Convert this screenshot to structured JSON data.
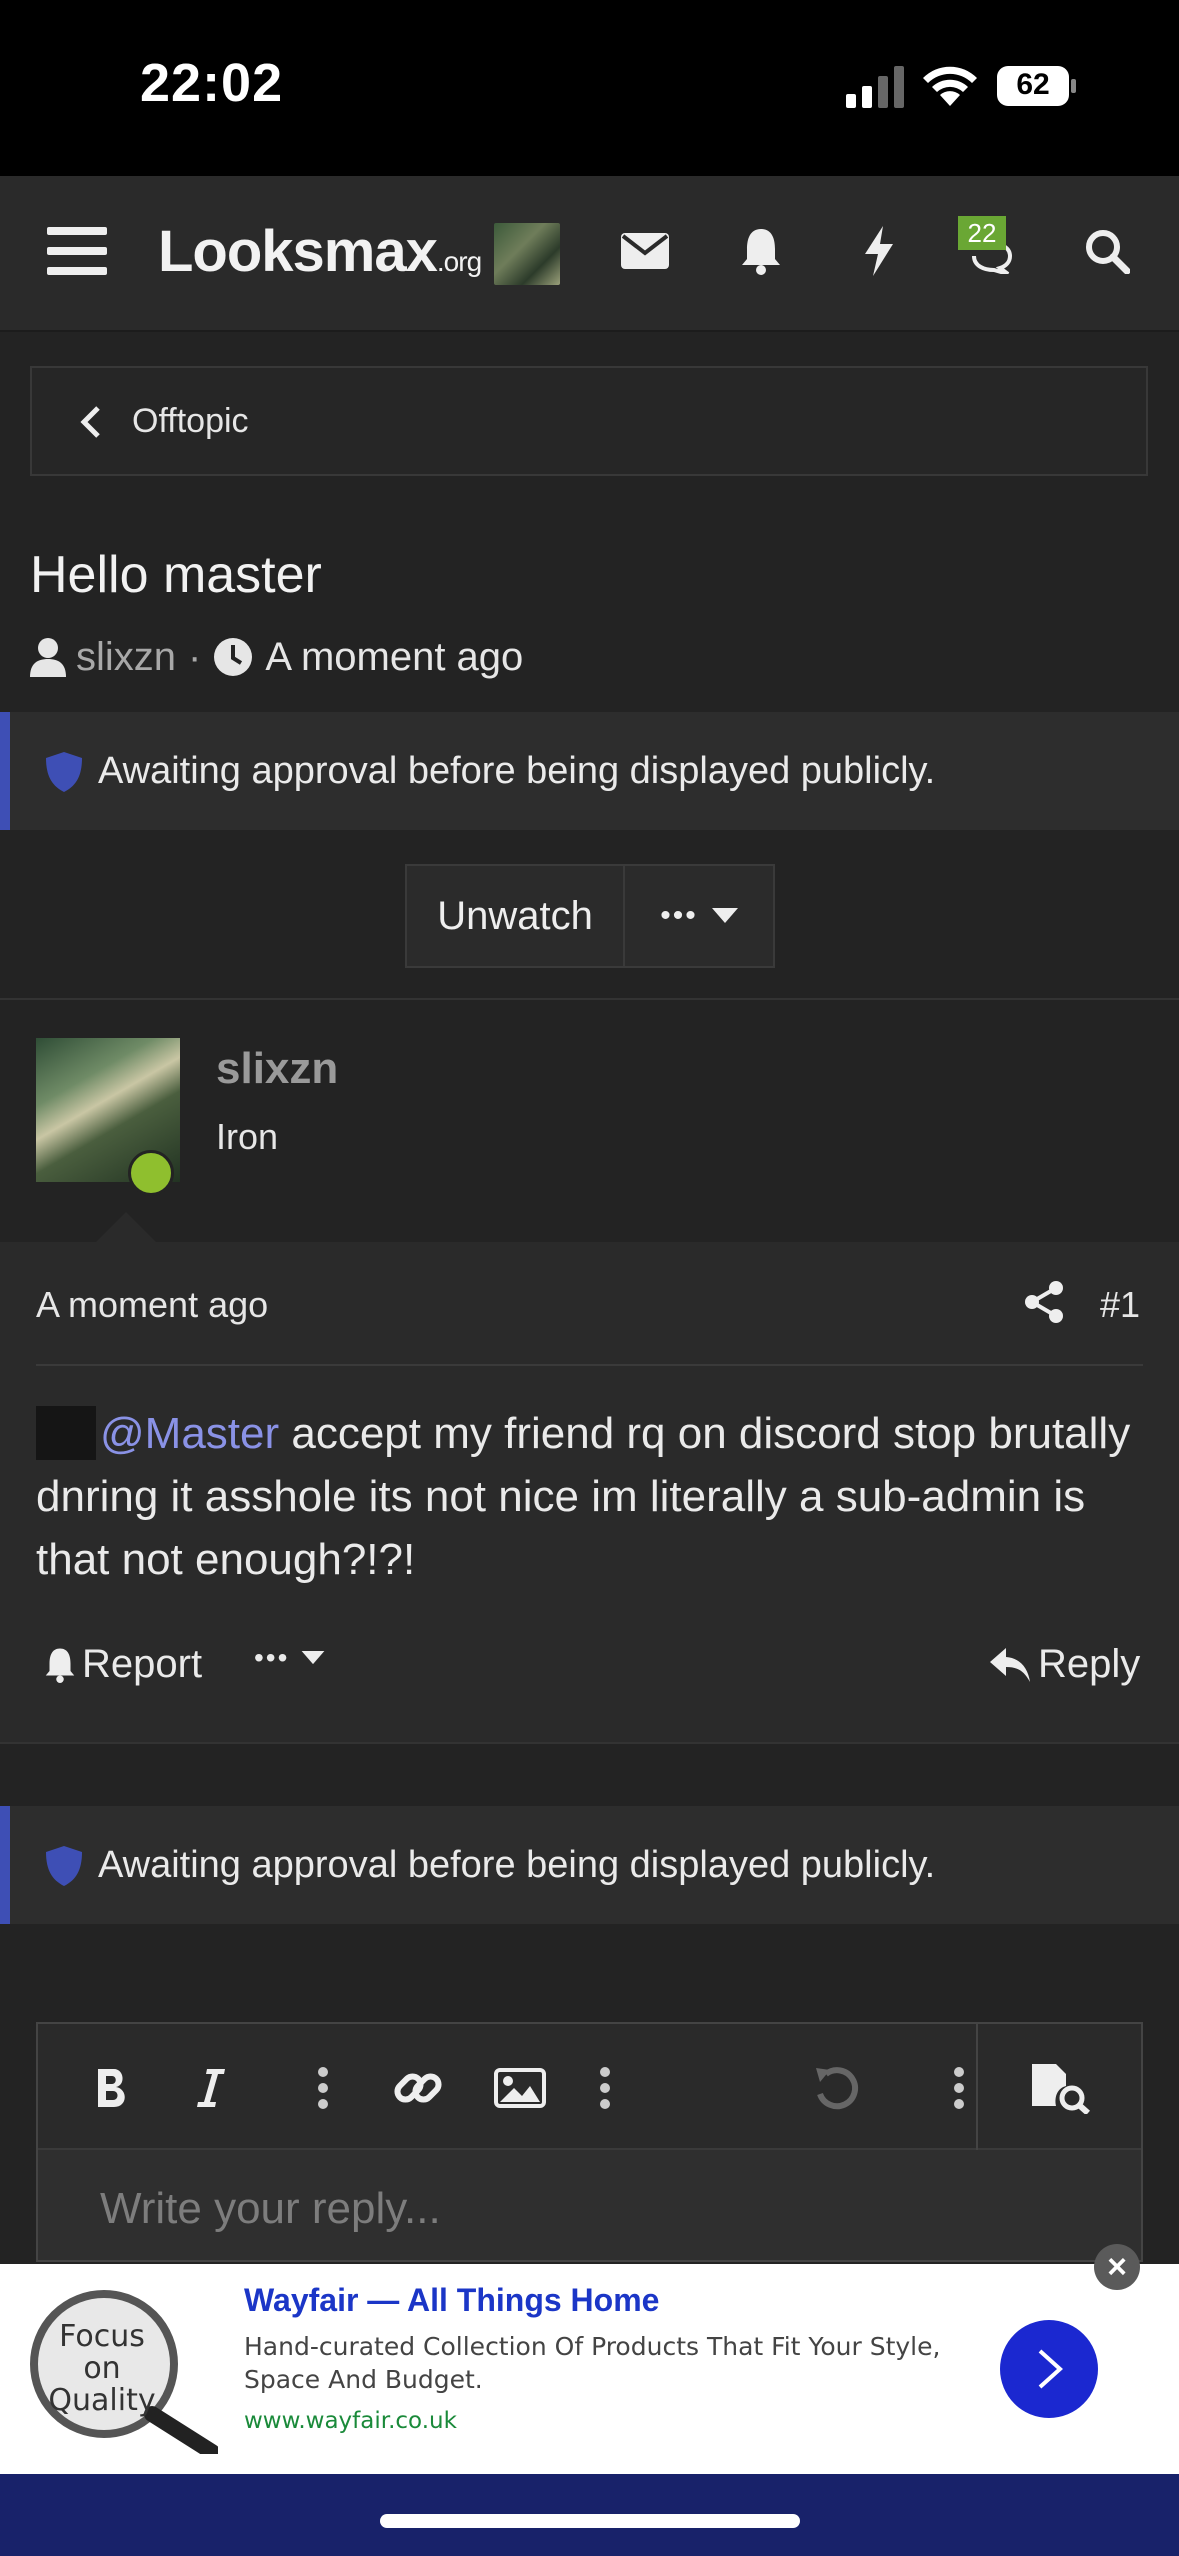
{
  "status_bar": {
    "time": "22:02",
    "battery": "62"
  },
  "nav": {
    "logo_main": "Looksmax",
    "logo_suffix": ".org",
    "chat_badge": "22"
  },
  "breadcrumb": {
    "label": "Offtopic"
  },
  "thread": {
    "title": "Hello master",
    "author": "slixzn",
    "separator": "·",
    "time": "A moment ago"
  },
  "notice": {
    "text": "Awaiting approval before being displayed publicly."
  },
  "buttons": {
    "unwatch": "Unwatch",
    "more": "•••"
  },
  "post": {
    "author": "slixzn",
    "rank": "Iron",
    "time": "A moment ago",
    "number": "#1",
    "mention": "@Master",
    "body": " accept my friend rq on discord stop brutally dnring it asshole its not nice im literally a sub-admin is that not enough?!?!",
    "report_label": "Report",
    "more_label": "•••",
    "reply_label": "Reply"
  },
  "editor": {
    "placeholder": "Write your reply..."
  },
  "ad": {
    "title": "Wayfair — All Things Home",
    "description": "Hand-curated Collection Of Products That Fit Your Style, Space And Budget.",
    "url": "www.wayfair.co.uk",
    "image_text": "Focus on Quality",
    "close": "×"
  },
  "colors": {
    "accent": "#3e4fb5",
    "mention": "#8a92e6",
    "online": "#8fbf2e",
    "badge": "#6aa734",
    "ad_link": "#1b36c7"
  }
}
